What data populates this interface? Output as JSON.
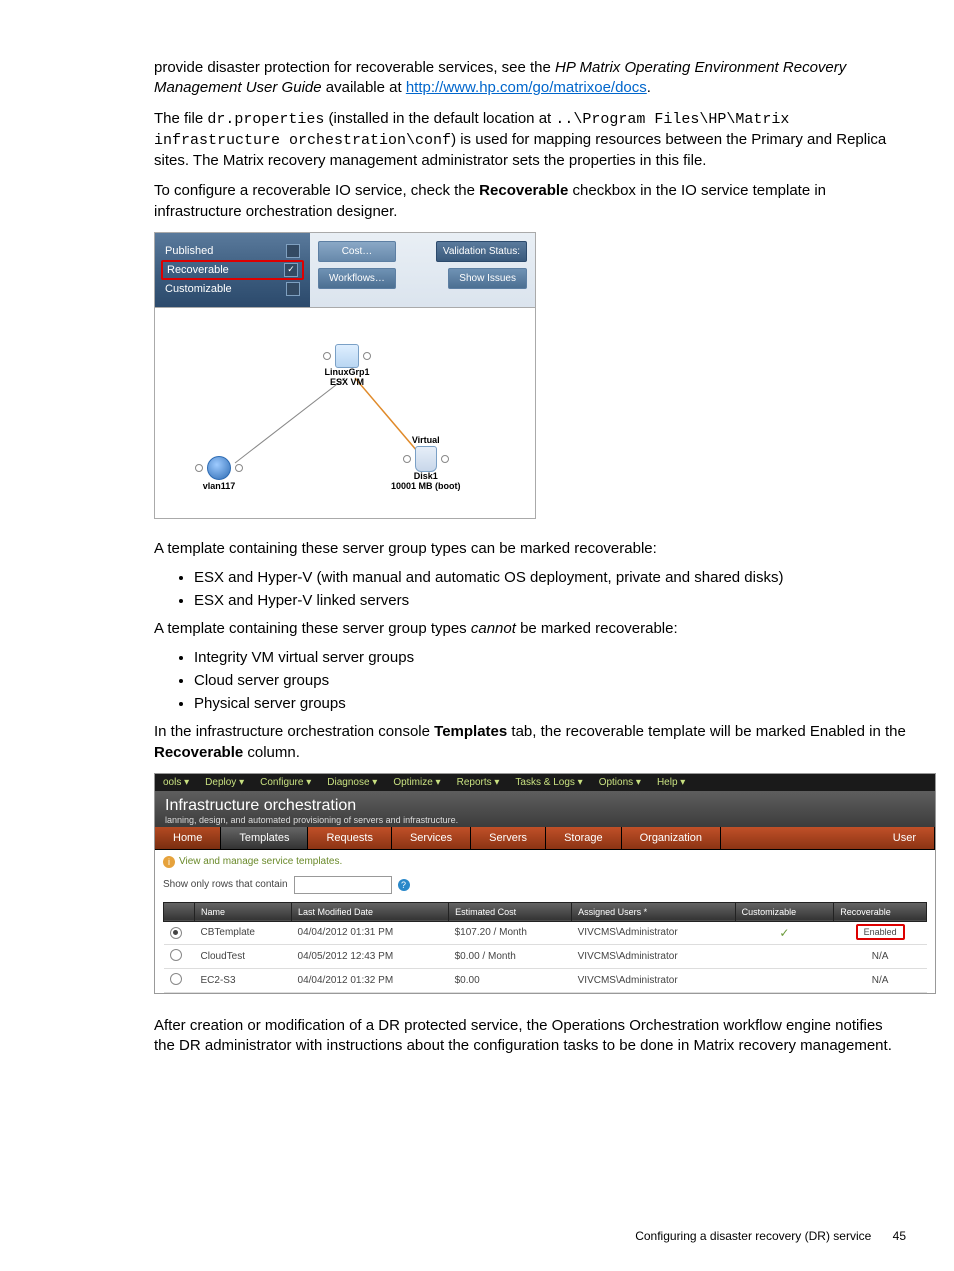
{
  "para1_a": "provide disaster protection for recoverable services, see the ",
  "para1_b": "HP Matrix Operating Environment Recovery Management User Guide",
  "para1_c": " available at ",
  "para1_link": "http://www.hp.com/go/matrixoe/docs",
  "para1_d": ".",
  "para2_a": "The file ",
  "para2_code1": "dr.properties",
  "para2_b": " (installed in the default location at ",
  "para2_code2": "..\\Program Files\\HP\\Matrix infrastructure orchestration\\conf",
  "para2_c": ") is used for mapping resources between the Primary and Replica sites. The Matrix recovery management administrator sets the properties in this file.",
  "para3_a": "To configure a recoverable IO service, check the ",
  "para3_bold": "Recoverable",
  "para3_b": " checkbox in the IO service template in infrastructure orchestration designer.",
  "shot1": {
    "published": "Published",
    "recoverable": "Recoverable",
    "customizable": "Customizable",
    "cost_btn": "Cost…",
    "workflows_btn": "Workflows…",
    "validation": "Validation Status:",
    "show_issues": "Show Issues",
    "vm_label1": "LinuxGrp1",
    "vm_label2": "ESX VM",
    "vlan": "vlan117",
    "virtual": "Virtual",
    "disk1": "Disk1",
    "disk2": "10001 MB (boot)"
  },
  "para4": "A template containing these server group types can be marked recoverable:",
  "list1": {
    "i0": "ESX and Hyper-V (with manual and automatic OS deployment, private and shared disks)",
    "i1": "ESX and Hyper-V linked servers"
  },
  "para5_a": "A template containing these server group types ",
  "para5_i": "cannot",
  "para5_b": " be marked recoverable:",
  "list2": {
    "i0": "Integrity VM virtual server groups",
    "i1": "Cloud server groups",
    "i2": "Physical server groups"
  },
  "para6_a": "In the infrastructure orchestration console ",
  "para6_b1": "Templates",
  "para6_b": " tab, the recoverable template will be marked Enabled in the ",
  "para6_b2": "Recoverable",
  "para6_c": " column.",
  "shot2": {
    "menu": {
      "m0": "ools ▾",
      "m1": "Deploy ▾",
      "m2": "Configure ▾",
      "m3": "Diagnose ▾",
      "m4": "Optimize ▾",
      "m5": "Reports ▾",
      "m6": "Tasks & Logs ▾",
      "m7": "Options ▾",
      "m8": "Help ▾"
    },
    "title": "Infrastructure orchestration",
    "subtitle": "lanning, design, and automated provisioning of servers and infrastructure.",
    "tabs": {
      "t0": "Home",
      "t1": "Templates",
      "t2": "Requests",
      "t3": "Services",
      "t4": "Servers",
      "t5": "Storage",
      "t6": "Organization",
      "t7": "User"
    },
    "hint": "View and manage service templates.",
    "filter_label": "Show only rows that contain",
    "cols": {
      "c0": "",
      "c1": "Name",
      "c2": "Last Modified Date",
      "c3": "Estimated Cost",
      "c4": "Assigned Users *",
      "c5": "Customizable",
      "c6": "Recoverable"
    },
    "rows": {
      "r0": {
        "name": "CBTemplate",
        "date": "04/04/2012 01:31 PM",
        "cost": "$107.20 / Month",
        "users": "VIVCMS\\Administrator",
        "cust": "✓",
        "rec": "Enabled"
      },
      "r1": {
        "name": "CloudTest",
        "date": "04/05/2012 12:43 PM",
        "cost": "$0.00 / Month",
        "users": "VIVCMS\\Administrator",
        "cust": "",
        "rec": "N/A"
      },
      "r2": {
        "name": "EC2-S3",
        "date": "04/04/2012 01:32 PM",
        "cost": "$0.00",
        "users": "VIVCMS\\Administrator",
        "cust": "",
        "rec": "N/A"
      }
    }
  },
  "para7": "After creation or modification of a DR protected service, the Operations Orchestration workflow engine notifies the DR administrator with instructions about the configuration tasks to be done in Matrix recovery management.",
  "footer_text": "Configuring a disaster recovery (DR) service",
  "footer_page": "45"
}
